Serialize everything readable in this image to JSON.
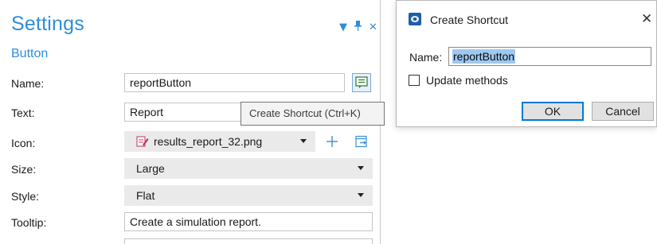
{
  "settings": {
    "title": "Settings",
    "subtitle": "Button",
    "header_icons": [
      "dropdown-arrow-icon",
      "pin-icon",
      "close-icon"
    ],
    "rows": [
      {
        "label": "Name:",
        "value": "reportButton",
        "kind": "input"
      },
      {
        "label": "Text:",
        "value": "Report",
        "kind": "input"
      },
      {
        "label": "Icon:",
        "value": "results_report_32.png",
        "kind": "combo"
      },
      {
        "label": "Size:",
        "value": "Large",
        "kind": "combo"
      },
      {
        "label": "Style:",
        "value": "Flat",
        "kind": "combo"
      },
      {
        "label": "Tooltip:",
        "value": "Create a simulation report.",
        "kind": "input"
      }
    ]
  },
  "tooltip": {
    "text": "Create Shortcut (Ctrl+K)"
  },
  "dialog": {
    "title": "Create Shortcut",
    "name_label": "Name:",
    "name_value": "reportButton",
    "checkbox_label": "Update methods",
    "checkbox_checked": false,
    "ok_label": "OK",
    "cancel_label": "Cancel"
  },
  "colors": {
    "accent": "#2f8dd8",
    "selection": "#9ec8f0",
    "focus": "#0078d7"
  }
}
